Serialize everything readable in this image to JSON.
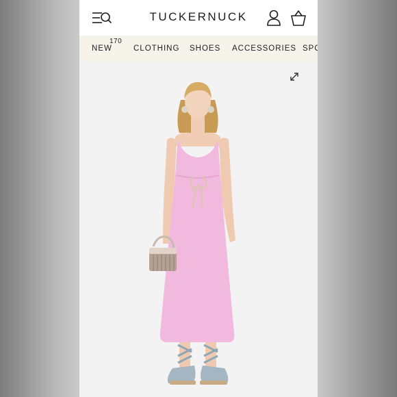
{
  "header": {
    "brand": "TUCKERNUCK",
    "menu_icon": "menu-search-icon",
    "account_icon": "user-icon",
    "bag_icon": "shopping-bag-icon"
  },
  "nav": {
    "badge": "170",
    "items": [
      {
        "label": "NEW"
      },
      {
        "label": "CLOTHING"
      },
      {
        "label": "SHOES"
      },
      {
        "label": "ACCESSORIES"
      },
      {
        "label": "SPO"
      }
    ]
  },
  "product": {
    "expand_icon": "expand-icon",
    "image_alt": "pink-linen-midi-dress"
  },
  "colors": {
    "accent_nav_bg": "#f6f3ea",
    "dress_pink": "#f2b9df",
    "text": "#1d1d1d"
  }
}
